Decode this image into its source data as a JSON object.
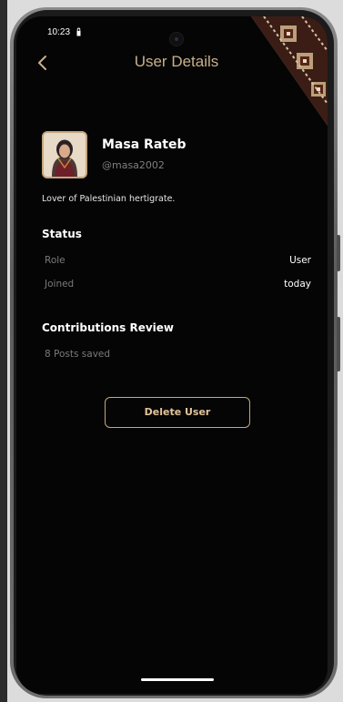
{
  "status_bar": {
    "time": "10:23",
    "icons": [
      "lock-icon",
      "wifi-icon",
      "signal-icon",
      "battery-icon"
    ]
  },
  "app_bar": {
    "title": "User Details",
    "back_icon": "chevron-left-icon"
  },
  "profile": {
    "name": "Masa Rateb",
    "handle": "@masa2002",
    "bio": "Lover of Palestinian hertigrate."
  },
  "status_section": {
    "heading": "Status",
    "rows": [
      {
        "label": "Role",
        "value": "User"
      },
      {
        "label": "Joined",
        "value": "today"
      }
    ]
  },
  "contributions": {
    "heading": "Contributions Review",
    "posts_saved": "8 Posts saved"
  },
  "actions": {
    "delete_label": "Delete User"
  },
  "colors": {
    "accent": "#c9b08b",
    "background": "#050505",
    "button_border": "#c6a57c",
    "muted_text": "#7a7a7a"
  }
}
